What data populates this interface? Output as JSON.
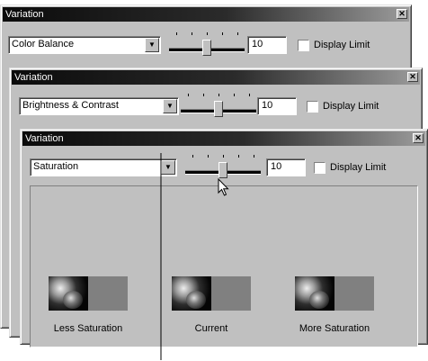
{
  "windows": [
    {
      "title": "Variation",
      "select_value": "Color Balance",
      "number_value": "10",
      "checkbox_label": "Display Limit",
      "close_glyph": "✕"
    },
    {
      "title": "Variation",
      "select_value": "Brightness & Contrast",
      "number_value": "10",
      "checkbox_label": "Display Limit",
      "close_glyph": "✕"
    },
    {
      "title": "Variation",
      "select_value": "Saturation",
      "number_value": "10",
      "checkbox_label": "Display Limit",
      "close_glyph": "✕",
      "previews": [
        {
          "label": "Less Saturation"
        },
        {
          "label": "Current"
        },
        {
          "label": "More Saturation"
        }
      ]
    }
  ],
  "dropdown_arrow_glyph": "▼",
  "slider_level": 0.5
}
